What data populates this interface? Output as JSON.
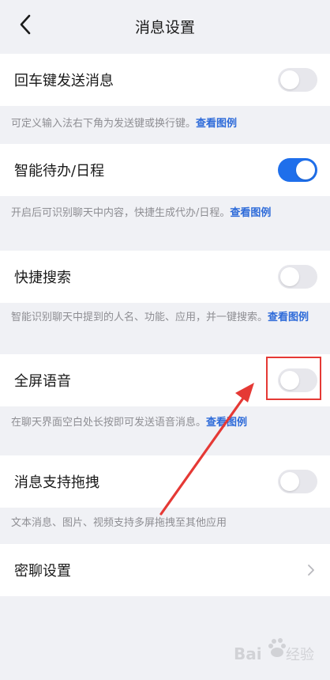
{
  "header": {
    "title": "消息设置"
  },
  "settings": [
    {
      "label": "回车键发送消息",
      "toggle": "off",
      "desc_text": "可定义输入法右下角为发送键或换行键。",
      "desc_link": "查看图例"
    },
    {
      "label": "智能待办/日程",
      "toggle": "on",
      "desc_text": "开启后可识别聊天中内容，快捷生成代办/日程。",
      "desc_link": "查看图例"
    },
    {
      "label": "快捷搜索",
      "toggle": "off",
      "desc_text": "智能识别聊天中提到的人名、功能、应用，并一键搜索。",
      "desc_link": "查看图例"
    },
    {
      "label": "全屏语音",
      "toggle": "off",
      "desc_text": "在聊天界面空白处长按即可发送语音消息。",
      "desc_link": "查看图例"
    },
    {
      "label": "消息支持拖拽",
      "toggle": "off",
      "desc_text": "文本消息、图片、视频支持多屏拖拽至其他应用"
    },
    {
      "label": "密聊设置"
    }
  ],
  "colors": {
    "accent": "#1f6feb",
    "link": "#2e6bd9",
    "annotation": "#e53935",
    "background": "#f0f1f5"
  },
  "icons": [
    "back-icon",
    "chevron-right-icon"
  ],
  "watermark": {
    "text": "Bai经验"
  }
}
